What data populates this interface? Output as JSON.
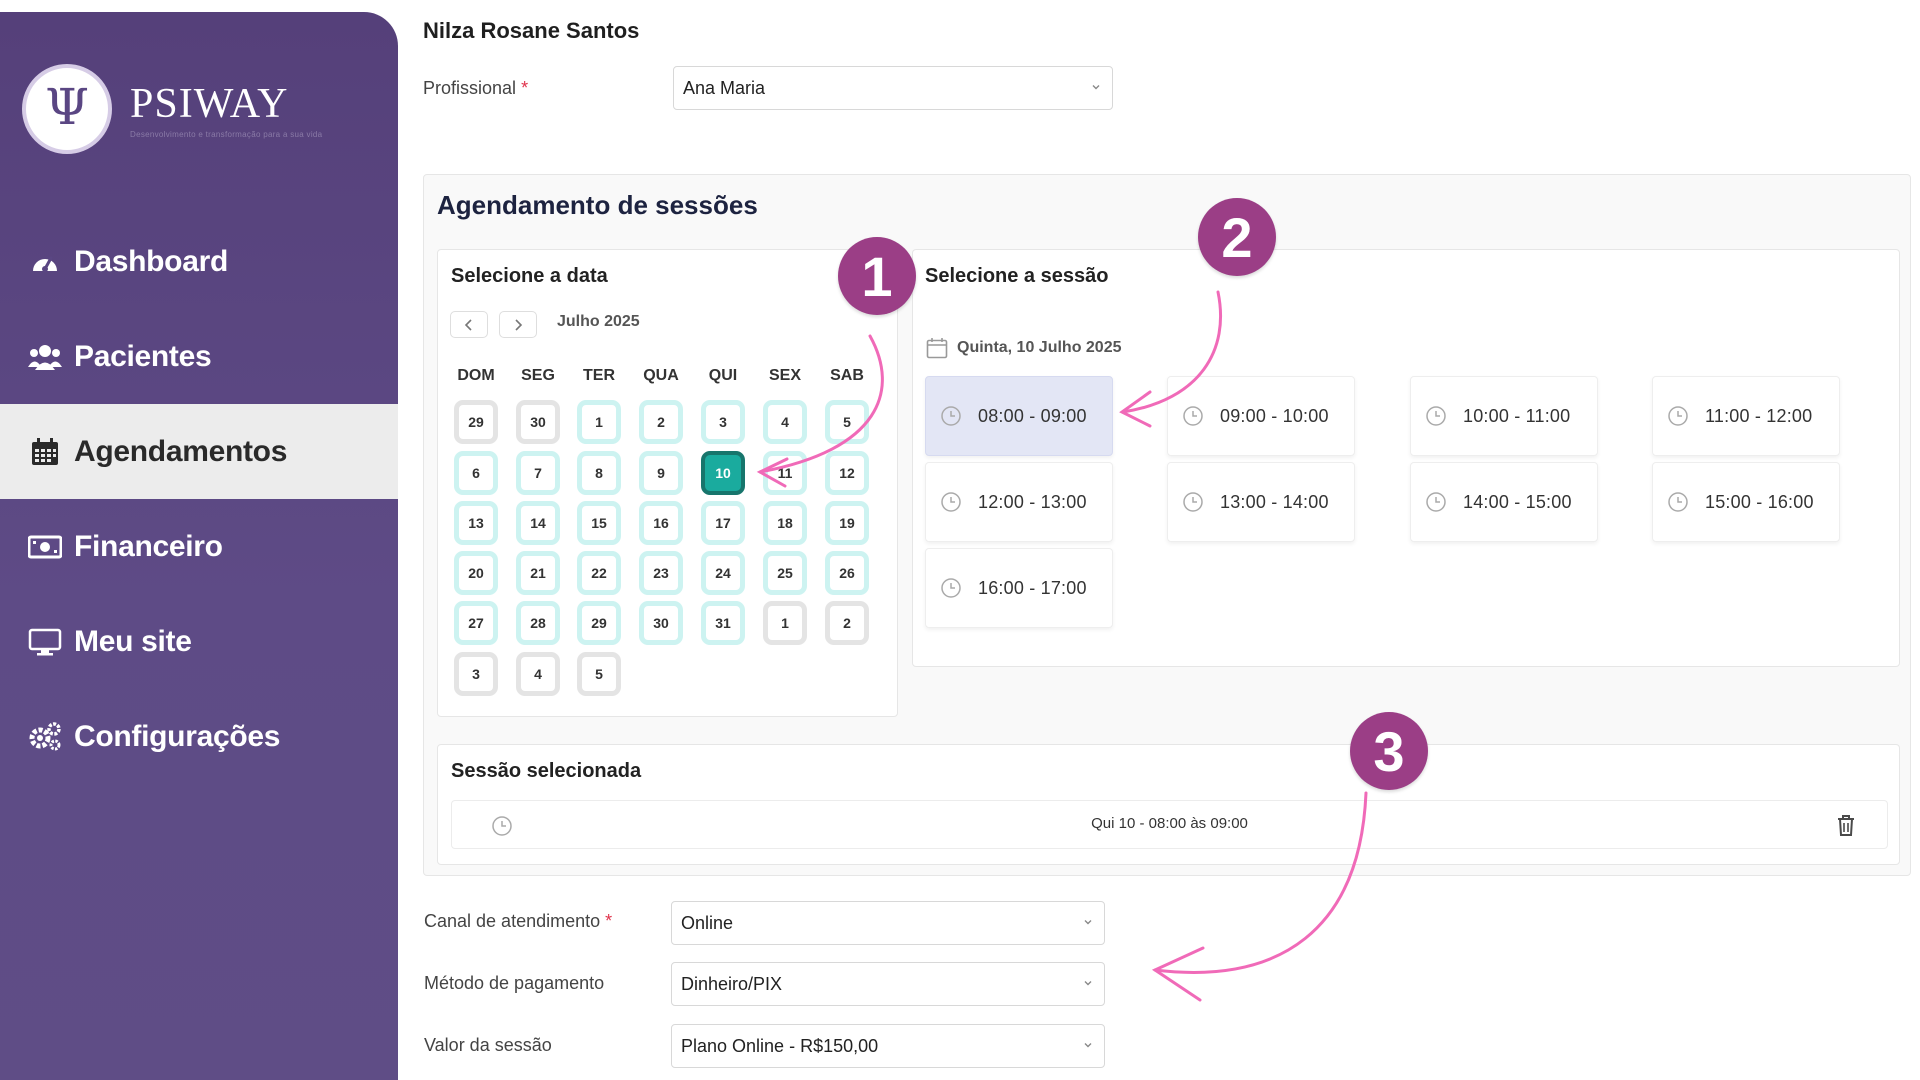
{
  "brand": {
    "name": "PSIWAY",
    "tagline": "Desenvolvimento e transformação para a sua vida",
    "symbol": "Ψ"
  },
  "nav": {
    "items": [
      {
        "label": "Dashboard",
        "icon": "gauge-icon"
      },
      {
        "label": "Pacientes",
        "icon": "users-icon"
      },
      {
        "label": "Agendamentos",
        "icon": "calendar-icon",
        "active": true
      },
      {
        "label": "Financeiro",
        "icon": "money-icon"
      },
      {
        "label": "Meu site",
        "icon": "monitor-icon"
      },
      {
        "label": "Configurações",
        "icon": "gears-icon"
      }
    ]
  },
  "patient": {
    "name": "Nilza Rosane Santos"
  },
  "form": {
    "professional_label": "Profissional",
    "required_mark": "*",
    "professional_value": "Ana Maria",
    "channel_label": "Canal de atendimento",
    "channel_value": "Online",
    "payment_label": "Método de pagamento",
    "payment_value": "Dinheiro/PIX",
    "price_label": "Valor da sessão",
    "price_value": "Plano Online - R$150,00"
  },
  "scheduling": {
    "title": "Agendamento de sessões",
    "date_card_title": "Selecione a data",
    "month_label": "Julho 2025",
    "weekdays": [
      "DOM",
      "SEG",
      "TER",
      "QUA",
      "QUI",
      "SEX",
      "SAB"
    ],
    "days": [
      [
        "29",
        "30",
        "1",
        "2",
        "3",
        "4",
        "5"
      ],
      [
        "6",
        "7",
        "8",
        "9",
        "10",
        "11",
        "12"
      ],
      [
        "13",
        "14",
        "15",
        "16",
        "17",
        "18",
        "19"
      ],
      [
        "20",
        "21",
        "22",
        "23",
        "24",
        "25",
        "26"
      ],
      [
        "27",
        "28",
        "29",
        "30",
        "31",
        "1",
        "2"
      ],
      [
        "3",
        "4",
        "5"
      ]
    ],
    "selected_day": "10",
    "session_card_title": "Selecione a sessão",
    "session_date": "Quinta, 10 Julho 2025",
    "slots": [
      "08:00 - 09:00",
      "09:00 - 10:00",
      "10:00 - 11:00",
      "11:00 - 12:00",
      "12:00 - 13:00",
      "13:00 - 14:00",
      "14:00 - 15:00",
      "15:00 - 16:00",
      "16:00 - 17:00"
    ],
    "selected_slot": "08:00 - 09:00",
    "selected_card_title": "Sessão selecionada",
    "selected_session_text": "Qui 10 - 08:00 às 09:00"
  },
  "annotations": [
    "1",
    "2",
    "3"
  ],
  "colors": {
    "sidebar": "#5a4683",
    "accent_teal": "#1aab9e",
    "badge": "#9b3e86",
    "arrow": "#f06ab8",
    "selected_slot_bg": "#e3e6f5"
  }
}
